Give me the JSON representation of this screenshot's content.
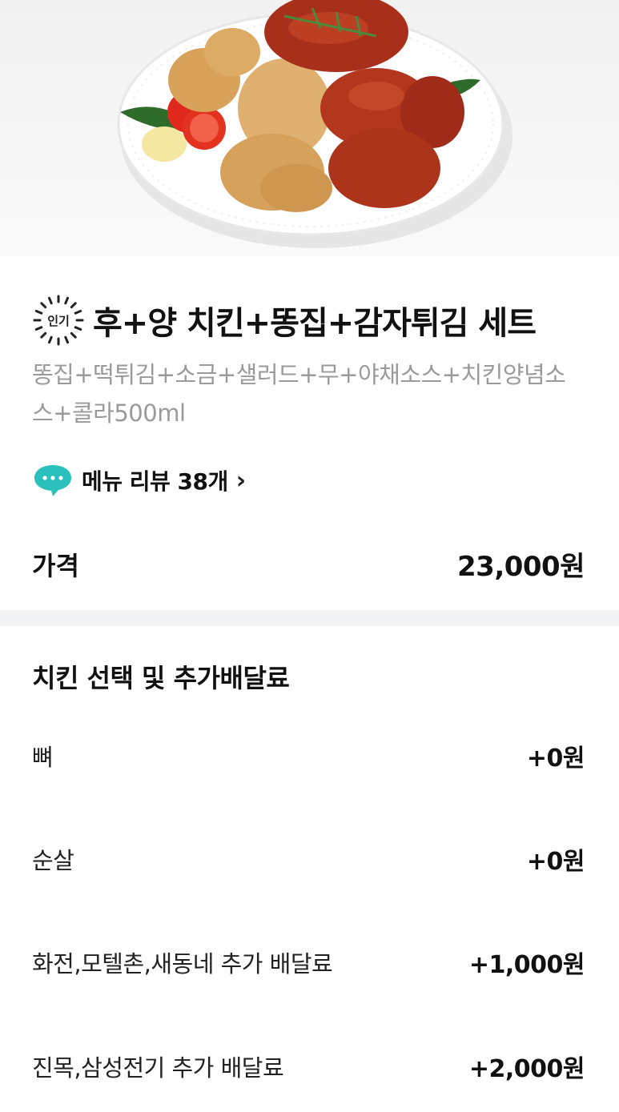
{
  "menu": {
    "badge": "인기",
    "title": "후+양 치킨+똥집+감자튀김 세트",
    "description": "똥집+떡튀김+소금+샐러드+무+야채소스+치킨양념소스+콜라500ml",
    "review_label": "메뉴 리뷰 38개",
    "review_chevron": "›",
    "price_label": "가격",
    "price_value": "23,000원"
  },
  "option_group": {
    "title": "치킨 선택 및 추가배달료",
    "options": [
      {
        "name": "뼈",
        "price": "+0원"
      },
      {
        "name": "순살",
        "price": "+0원"
      },
      {
        "name": "화전,모텔촌,새동네 추가 배달료",
        "price": "+1,000원"
      },
      {
        "name": "진목,삼성전기 추가 배달료",
        "price": "+2,000원"
      }
    ]
  },
  "colors": {
    "divider": "#f2f3f5",
    "review_icon": "#2ac1bc",
    "description": "#9a9a9a"
  },
  "icons": {
    "badge": "popular-badge-icon",
    "review": "speech-bubble-icon"
  }
}
